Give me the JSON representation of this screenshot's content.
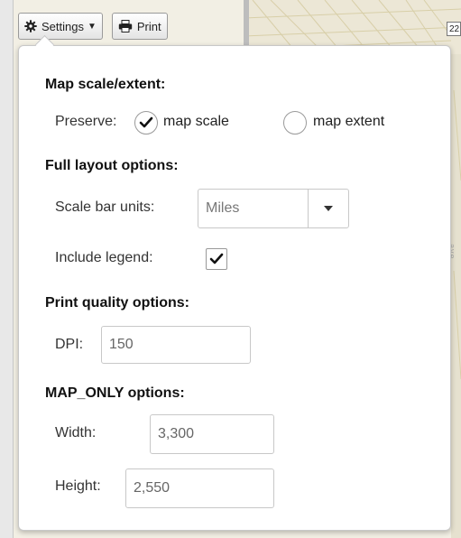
{
  "toolbar": {
    "settings_label": "Settings",
    "print_label": "Print"
  },
  "map": {
    "corner_label": "22",
    "side_text": "ave"
  },
  "panel": {
    "map_scale_heading": "Map scale/extent:",
    "preserve_label": "Preserve:",
    "map_scale_option": "map scale",
    "map_extent_option": "map extent",
    "preserve_selected": "map scale",
    "full_layout_heading": "Full layout options:",
    "scale_bar_units_label": "Scale bar units:",
    "scale_bar_units_value": "Miles",
    "include_legend_label": "Include legend:",
    "include_legend_checked": true,
    "print_quality_heading": "Print quality options:",
    "dpi_label": "DPI:",
    "dpi_value": "150",
    "map_only_heading": "MAP_ONLY options:",
    "width_label": "Width:",
    "width_value": "3,300",
    "height_label": "Height:",
    "height_value": "2,550"
  },
  "icons": {
    "settings": "gear-icon",
    "print": "printer-icon",
    "caret": "caret-down-icon",
    "check": "check-icon"
  }
}
